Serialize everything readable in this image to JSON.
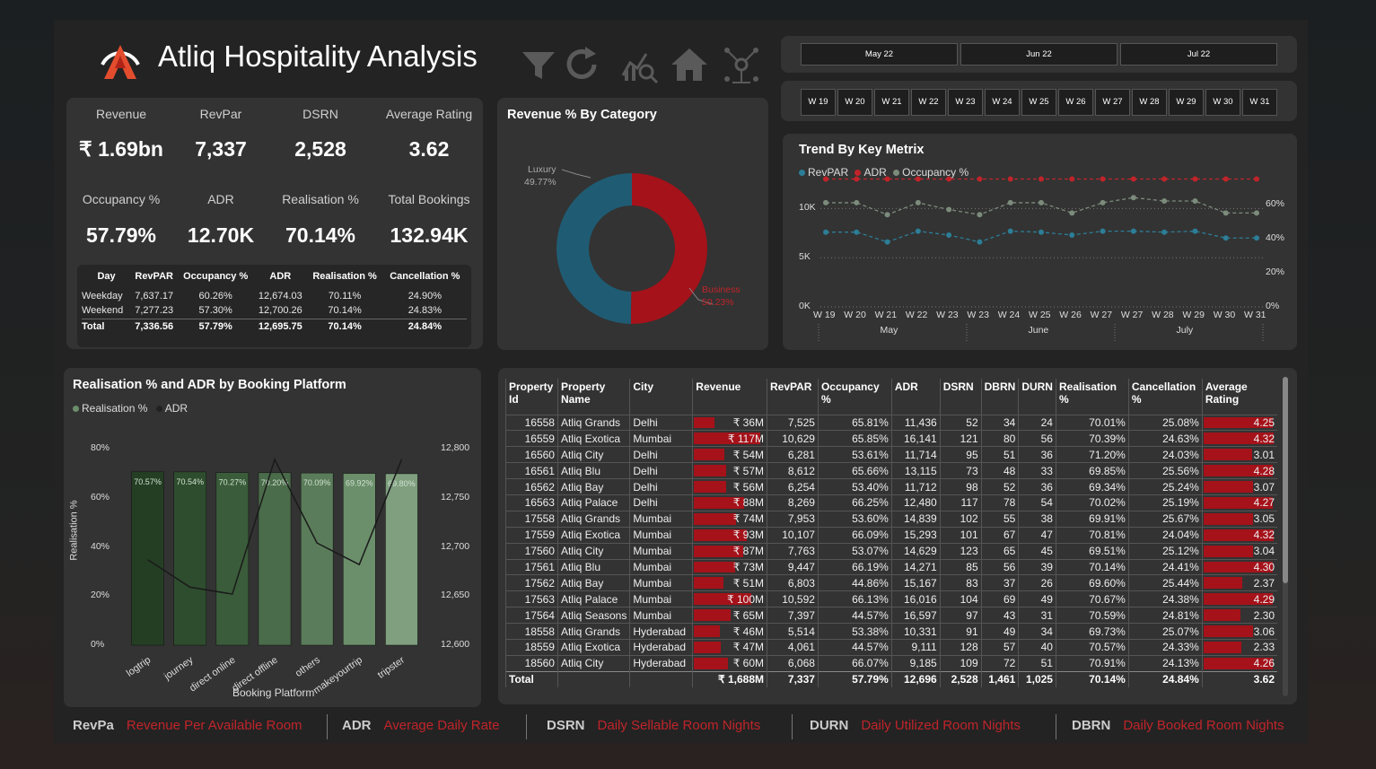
{
  "header": {
    "title": "Atliq Hospitality Analysis"
  },
  "toolbar_icons": [
    "filter-icon",
    "refresh-icon",
    "analytics-icon",
    "home-icon",
    "network-icon"
  ],
  "months": [
    "May 22",
    "Jun 22",
    "Jul 22"
  ],
  "weeks": [
    "W 19",
    "W 20",
    "W 21",
    "W 22",
    "W 23",
    "W 24",
    "W 25",
    "W 26",
    "W 27",
    "W 28",
    "W 29",
    "W 30",
    "W 31"
  ],
  "kpis": [
    {
      "label": "Revenue",
      "value": "₹ 1.69bn"
    },
    {
      "label": "RevPar",
      "value": "7,337"
    },
    {
      "label": "DSRN",
      "value": "2,528"
    },
    {
      "label": "Average Rating",
      "value": "3.62"
    },
    {
      "label": "Occupancy %",
      "value": "57.79%"
    },
    {
      "label": "ADR",
      "value": "12.70K"
    },
    {
      "label": "Realisation %",
      "value": "70.14%"
    },
    {
      "label": "Total Bookings",
      "value": "132.94K"
    }
  ],
  "day_table": {
    "headers": [
      "Day",
      "RevPAR",
      "Occupancy %",
      "ADR",
      "Realisation %",
      "Cancellation %"
    ],
    "rows": [
      [
        "Weekday",
        "7,637.17",
        "60.26%",
        "12,674.03",
        "70.11%",
        "24.90%"
      ],
      [
        "Weekend",
        "7,277.23",
        "57.30%",
        "12,700.26",
        "70.14%",
        "24.83%"
      ]
    ],
    "total": [
      "Total",
      "7,336.56",
      "57.79%",
      "12,695.75",
      "70.14%",
      "24.84%"
    ]
  },
  "donut": {
    "title": "Revenue % By Category",
    "slices": [
      {
        "label": "Luxury",
        "value": "49.77%",
        "pct": 49.77,
        "color": "#1f5c73"
      },
      {
        "label": "Business",
        "value": "50.23%",
        "pct": 50.23,
        "color": "#a5121a"
      }
    ]
  },
  "trend": {
    "title": "Trend By Key Metrix",
    "legend": [
      {
        "name": "RevPAR",
        "color": "#2c7e97"
      },
      {
        "name": "ADR",
        "color": "#c0242a"
      },
      {
        "name": "Occupancy %",
        "color": "#7c8c7c"
      }
    ],
    "y_left": [
      "10K",
      "5K",
      "0K"
    ],
    "y_right": [
      "60%",
      "40%",
      "20%",
      "0%"
    ],
    "x": [
      "W 19",
      "W 20",
      "W 21",
      "W 22",
      "W 23",
      "W 23",
      "W 24",
      "W 25",
      "W 26",
      "W 27",
      "W 27",
      "W 28",
      "W 29",
      "W 30",
      "W 31"
    ],
    "months": [
      "May",
      "June",
      "July"
    ]
  },
  "chart_data": [
    {
      "type": "line",
      "title": "Trend By Key Metrix",
      "x": [
        "W 19",
        "W 20",
        "W 21",
        "W 22",
        "W 23",
        "W 23",
        "W 24",
        "W 25",
        "W 26",
        "W 27",
        "W 27",
        "W 28",
        "W 29",
        "W 30",
        "W 31"
      ],
      "ylim": [
        0,
        12500
      ],
      "series": [
        {
          "name": "RevPAR",
          "axis": "left",
          "values": [
            7600,
            7600,
            6600,
            7700,
            7300,
            6600,
            7700,
            7600,
            7300,
            7700,
            7700,
            7600,
            7700,
            7000,
            7000
          ]
        },
        {
          "name": "ADR",
          "axis": "left",
          "values": [
            13000,
            13000,
            13000,
            13000,
            13000,
            13000,
            13000,
            13000,
            13000,
            13000,
            13000,
            13000,
            13000,
            13000,
            13000
          ]
        }
      ],
      "series_right": [
        {
          "name": "Occupancy %",
          "values": [
            61,
            61,
            54,
            61,
            57,
            54,
            61,
            61,
            55,
            61,
            64,
            62,
            62,
            55,
            55
          ]
        }
      ],
      "ylim_right": [
        0,
        72
      ]
    },
    {
      "type": "bar",
      "title": "Realisation % and ADR by Booking Platform",
      "xlabel": "Booking Platform",
      "ylabel": "Realisation %",
      "categories": [
        "logtrip",
        "journey",
        "direct online",
        "direct offline",
        "others",
        "makeyourtrip",
        "tripster"
      ],
      "ylim": [
        0,
        80
      ],
      "series": [
        {
          "name": "Realisation %",
          "values": [
            70.57,
            70.54,
            70.27,
            70.2,
            70.09,
            69.92,
            69.8
          ],
          "labels": [
            "70.57%",
            "70.54%",
            "70.27%",
            "70.20%",
            "70.09%",
            "69.92%",
            "69.80%"
          ]
        },
        {
          "name": "ADR",
          "axis": "right",
          "values": [
            12687,
            12659,
            12652,
            12789,
            12704,
            12682,
            12789
          ]
        }
      ],
      "ylim_right": [
        12600,
        12800
      ]
    }
  ],
  "platform": {
    "title": "Realisation % and ADR by Booking Platform",
    "legend": [
      {
        "name": "Realisation %",
        "color": "#6b8f6b"
      },
      {
        "name": "ADR",
        "color": "#222"
      }
    ],
    "y_left": [
      "80%",
      "60%",
      "40%",
      "20%",
      "0%"
    ],
    "y_right": [
      "12,800",
      "12,750",
      "12,700",
      "12,650",
      "12,600"
    ],
    "ylabel": "Realisation %",
    "xlabel": "Booking Platform"
  },
  "property_table": {
    "headers": [
      "Property Id",
      "Property Name",
      "City",
      "Revenue",
      "RevPAR",
      "Occupancy %",
      "ADR",
      "DSRN",
      "DBRN",
      "DURN",
      "Realisation %",
      "Cancellation %",
      "Average Rating"
    ],
    "rows": [
      [
        "16558",
        "Atliq Grands",
        "Delhi",
        "₹ 36M",
        "7,525",
        "65.81%",
        "11,436",
        "52",
        "34",
        "24",
        "70.01%",
        "25.08%",
        "4.25"
      ],
      [
        "16559",
        "Atliq Exotica",
        "Mumbai",
        "₹ 117M",
        "10,629",
        "65.85%",
        "16,141",
        "121",
        "80",
        "56",
        "70.39%",
        "24.63%",
        "4.32"
      ],
      [
        "16560",
        "Atliq City",
        "Delhi",
        "₹ 54M",
        "6,281",
        "53.61%",
        "11,714",
        "95",
        "51",
        "36",
        "71.20%",
        "24.03%",
        "3.01"
      ],
      [
        "16561",
        "Atliq Blu",
        "Delhi",
        "₹ 57M",
        "8,612",
        "65.66%",
        "13,115",
        "73",
        "48",
        "33",
        "69.85%",
        "25.56%",
        "4.28"
      ],
      [
        "16562",
        "Atliq Bay",
        "Delhi",
        "₹ 56M",
        "6,254",
        "53.40%",
        "11,712",
        "98",
        "52",
        "36",
        "69.34%",
        "25.24%",
        "3.07"
      ],
      [
        "16563",
        "Atliq Palace",
        "Delhi",
        "₹ 88M",
        "8,269",
        "66.25%",
        "12,480",
        "117",
        "78",
        "54",
        "70.02%",
        "25.19%",
        "4.27"
      ],
      [
        "17558",
        "Atliq Grands",
        "Mumbai",
        "₹ 74M",
        "7,953",
        "53.60%",
        "14,839",
        "102",
        "55",
        "38",
        "69.91%",
        "25.67%",
        "3.05"
      ],
      [
        "17559",
        "Atliq Exotica",
        "Mumbai",
        "₹ 93M",
        "10,107",
        "66.09%",
        "15,293",
        "101",
        "67",
        "47",
        "70.81%",
        "24.04%",
        "4.32"
      ],
      [
        "17560",
        "Atliq City",
        "Mumbai",
        "₹ 87M",
        "7,763",
        "53.07%",
        "14,629",
        "123",
        "65",
        "45",
        "69.51%",
        "25.12%",
        "3.04"
      ],
      [
        "17561",
        "Atliq Blu",
        "Mumbai",
        "₹ 73M",
        "9,447",
        "66.19%",
        "14,271",
        "85",
        "56",
        "39",
        "70.14%",
        "24.41%",
        "4.30"
      ],
      [
        "17562",
        "Atliq Bay",
        "Mumbai",
        "₹ 51M",
        "6,803",
        "44.86%",
        "15,167",
        "83",
        "37",
        "26",
        "69.60%",
        "25.44%",
        "2.37"
      ],
      [
        "17563",
        "Atliq Palace",
        "Mumbai",
        "₹ 100M",
        "10,592",
        "66.13%",
        "16,016",
        "104",
        "69",
        "49",
        "70.67%",
        "24.38%",
        "4.29"
      ],
      [
        "17564",
        "Atliq Seasons",
        "Mumbai",
        "₹ 65M",
        "7,397",
        "44.57%",
        "16,597",
        "97",
        "43",
        "31",
        "70.59%",
        "24.81%",
        "2.30"
      ],
      [
        "18558",
        "Atliq Grands",
        "Hyderabad",
        "₹ 46M",
        "5,514",
        "53.38%",
        "10,331",
        "91",
        "49",
        "34",
        "69.73%",
        "25.07%",
        "3.06"
      ],
      [
        "18559",
        "Atliq Exotica",
        "Hyderabad",
        "₹ 47M",
        "4,061",
        "44.57%",
        "9,111",
        "128",
        "57",
        "40",
        "70.57%",
        "24.33%",
        "2.33"
      ],
      [
        "18560",
        "Atliq City",
        "Hyderabad",
        "₹ 60M",
        "6,068",
        "66.07%",
        "9,185",
        "109",
        "72",
        "51",
        "70.91%",
        "24.13%",
        "4.26"
      ]
    ],
    "revenue_m": [
      36,
      117,
      54,
      57,
      56,
      88,
      74,
      93,
      87,
      73,
      51,
      100,
      65,
      46,
      47,
      60
    ],
    "ratings": [
      4.25,
      4.32,
      3.01,
      4.28,
      3.07,
      4.27,
      3.05,
      4.32,
      3.04,
      4.3,
      2.37,
      4.29,
      2.3,
      3.06,
      2.33,
      4.26
    ],
    "total": [
      "Total",
      "",
      "",
      "₹ 1,688M",
      "7,337",
      "57.79%",
      "12,696",
      "2,528",
      "1,461",
      "1,025",
      "70.14%",
      "24.84%",
      "3.62"
    ]
  },
  "footer": [
    {
      "abbr": "RevPa",
      "desc": "Revenue Per Available Room"
    },
    {
      "abbr": "ADR",
      "desc": "Average Daily Rate"
    },
    {
      "abbr": "DSRN",
      "desc": "Daily Sellable Room Nights"
    },
    {
      "abbr": "DURN",
      "desc": "Daily Utilized Room Nights"
    },
    {
      "abbr": "DBRN",
      "desc": "Daily Booked Room Nights"
    }
  ]
}
